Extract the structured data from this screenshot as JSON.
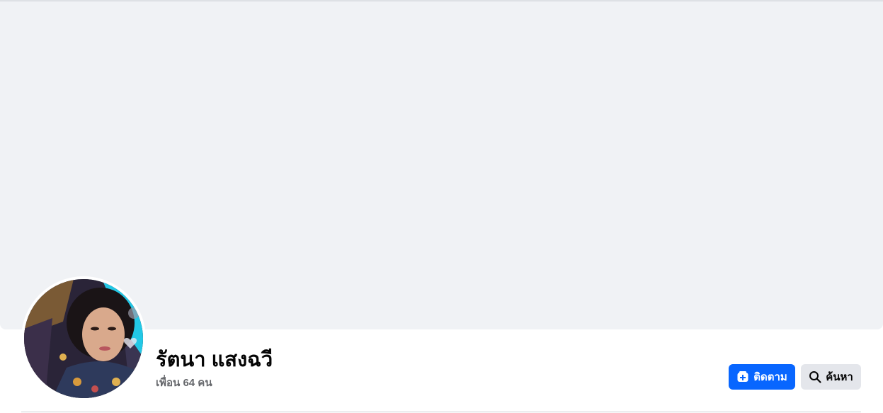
{
  "profile": {
    "name": "รัตนา แสงฉวี",
    "friends": "เพื่อน 64 คน"
  },
  "actions": {
    "follow_label": "ติดตาม",
    "follow_icon": "follow-plus-icon",
    "search_label": "ค้นหา",
    "search_icon": "search-icon"
  },
  "colors": {
    "accent": "#0866ff",
    "cover": "#f0f2f5",
    "secondary_button": "#e4e6eb"
  }
}
